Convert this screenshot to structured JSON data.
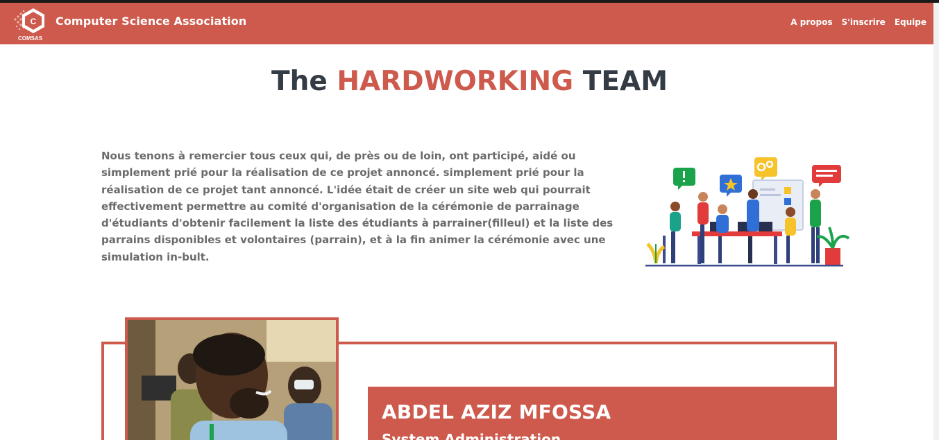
{
  "navbar": {
    "logo_text": "COMSAS",
    "brand": "Computer Science Association",
    "links": [
      {
        "label": "A propos"
      },
      {
        "label": "S'inscrire"
      },
      {
        "label": "Equipe"
      }
    ],
    "color": "#cd5a4c"
  },
  "hero": {
    "title_prefix": "The ",
    "title_accent": "HARDWORKING",
    "title_suffix": " TEAM",
    "accent_color": "#cd5a4c"
  },
  "intro": {
    "text": "Nous tenons à remercier tous ceux qui, de près ou de loin, ont participé, aidé ou simplement prié pour la réalisation de ce projet annoncé. simplement prié pour la réalisation de ce projet tant annoncé. L'idée était de créer un site web qui pourrait effectivement permettre au comité d'organisation de la cérémonie de parrainage d'étudiants d'obtenir facilement la liste des étudiants à parrainer(filleul) et la liste des parrains disponibles et volontaires (parrain), et à la fin animer la cérémonie avec une simulation in-bult."
  },
  "illustration": {
    "icon": "team-meeting-illustration"
  },
  "profile": {
    "name": "ABDEL AZIZ MFOSSA",
    "role": "System Administration",
    "photo_icon": "profile-photo"
  }
}
